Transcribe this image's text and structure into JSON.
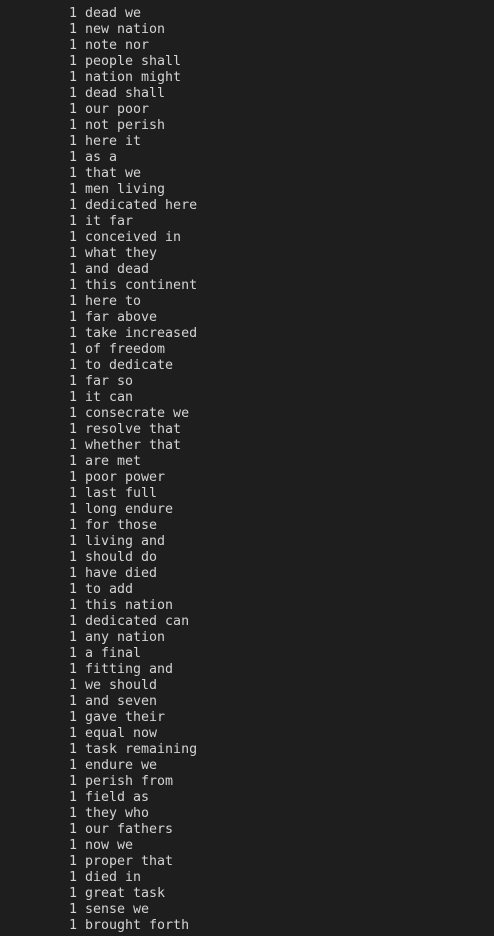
{
  "output": {
    "rows": [
      {
        "count": "1",
        "text": "dead we"
      },
      {
        "count": "1",
        "text": "new nation"
      },
      {
        "count": "1",
        "text": "note nor"
      },
      {
        "count": "1",
        "text": "people shall"
      },
      {
        "count": "1",
        "text": "nation might"
      },
      {
        "count": "1",
        "text": "dead shall"
      },
      {
        "count": "1",
        "text": "our poor"
      },
      {
        "count": "1",
        "text": "not perish"
      },
      {
        "count": "1",
        "text": "here it"
      },
      {
        "count": "1",
        "text": "as a"
      },
      {
        "count": "1",
        "text": "that we"
      },
      {
        "count": "1",
        "text": "men living"
      },
      {
        "count": "1",
        "text": "dedicated here"
      },
      {
        "count": "1",
        "text": "it far"
      },
      {
        "count": "1",
        "text": "conceived in"
      },
      {
        "count": "1",
        "text": "what they"
      },
      {
        "count": "1",
        "text": "and dead"
      },
      {
        "count": "1",
        "text": "this continent"
      },
      {
        "count": "1",
        "text": "here to"
      },
      {
        "count": "1",
        "text": "far above"
      },
      {
        "count": "1",
        "text": "take increased"
      },
      {
        "count": "1",
        "text": "of freedom"
      },
      {
        "count": "1",
        "text": "to dedicate"
      },
      {
        "count": "1",
        "text": "far so"
      },
      {
        "count": "1",
        "text": "it can"
      },
      {
        "count": "1",
        "text": "consecrate we"
      },
      {
        "count": "1",
        "text": "resolve that"
      },
      {
        "count": "1",
        "text": "whether that"
      },
      {
        "count": "1",
        "text": "are met"
      },
      {
        "count": "1",
        "text": "poor power"
      },
      {
        "count": "1",
        "text": "last full"
      },
      {
        "count": "1",
        "text": "long endure"
      },
      {
        "count": "1",
        "text": "for those"
      },
      {
        "count": "1",
        "text": "living and"
      },
      {
        "count": "1",
        "text": "should do"
      },
      {
        "count": "1",
        "text": "have died"
      },
      {
        "count": "1",
        "text": "to add"
      },
      {
        "count": "1",
        "text": "this nation"
      },
      {
        "count": "1",
        "text": "dedicated can"
      },
      {
        "count": "1",
        "text": "any nation"
      },
      {
        "count": "1",
        "text": "a final"
      },
      {
        "count": "1",
        "text": "fitting and"
      },
      {
        "count": "1",
        "text": "we should"
      },
      {
        "count": "1",
        "text": "and seven"
      },
      {
        "count": "1",
        "text": "gave their"
      },
      {
        "count": "1",
        "text": "equal now"
      },
      {
        "count": "1",
        "text": "task remaining"
      },
      {
        "count": "1",
        "text": "endure we"
      },
      {
        "count": "1",
        "text": "perish from"
      },
      {
        "count": "1",
        "text": "field as"
      },
      {
        "count": "1",
        "text": "they who"
      },
      {
        "count": "1",
        "text": "our fathers"
      },
      {
        "count": "1",
        "text": "now we"
      },
      {
        "count": "1",
        "text": "proper that"
      },
      {
        "count": "1",
        "text": "died in"
      },
      {
        "count": "1",
        "text": "great task"
      },
      {
        "count": "1",
        "text": "sense we"
      },
      {
        "count": "1",
        "text": "brought forth"
      }
    ]
  }
}
